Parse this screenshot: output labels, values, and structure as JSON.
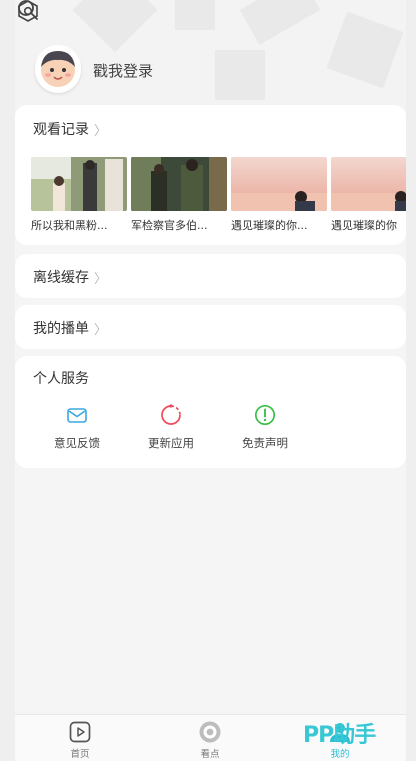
{
  "user": {
    "login_label": "戳我登录"
  },
  "history": {
    "title": "观看记录",
    "items": [
      {
        "caption": "所以我和黑粉..."
      },
      {
        "caption": "军检察官多伯..."
      },
      {
        "caption": "遇见璀璨的你..."
      },
      {
        "caption": "遇见璀璨的你"
      }
    ]
  },
  "offline": {
    "title": "离线缓存"
  },
  "playlist": {
    "title": "我的播单"
  },
  "services": {
    "title": "个人服务",
    "items": [
      {
        "label": "意见反馈",
        "color": "#3aa8e0"
      },
      {
        "label": "更新应用",
        "color": "#f04a5a"
      },
      {
        "label": "免责声明",
        "color": "#3cbf4a"
      }
    ]
  },
  "tabs": [
    {
      "label": "首页",
      "icon": "play-square-icon"
    },
    {
      "label": "看点",
      "icon": "view-circle-icon"
    },
    {
      "label": "我的",
      "icon": "user-icon"
    }
  ],
  "watermark": "PP助手",
  "colors": {
    "accent": "#2bbfd6"
  }
}
